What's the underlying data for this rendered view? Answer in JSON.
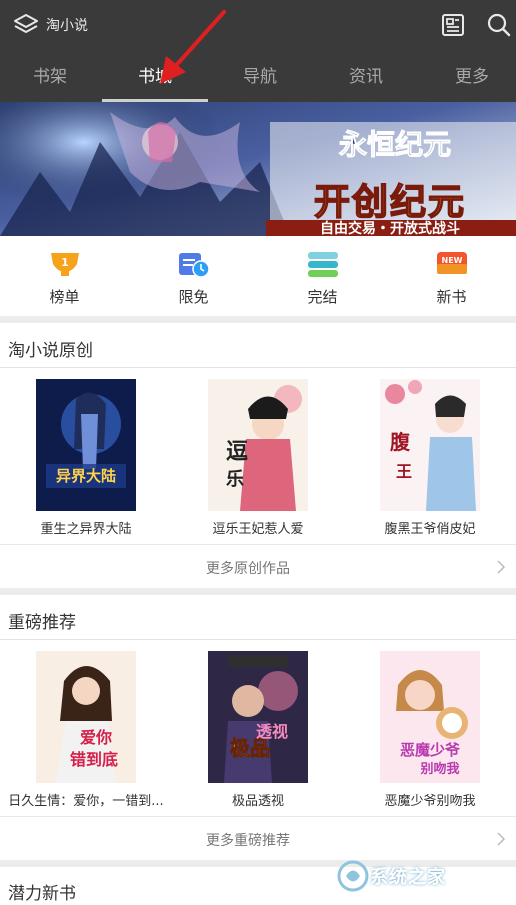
{
  "header": {
    "app_title": "淘小说",
    "logo_icon": "layers-icon",
    "actions": [
      {
        "icon": "reader-icon"
      },
      {
        "icon": "search-icon"
      }
    ]
  },
  "tabs": [
    {
      "label": "书架",
      "active": false
    },
    {
      "label": "书城",
      "active": true
    },
    {
      "label": "导航",
      "active": false
    },
    {
      "label": "资讯",
      "active": false
    },
    {
      "label": "更多",
      "active": false
    }
  ],
  "banner": {
    "title_logo": "永恒纪元",
    "headline": "开创纪元",
    "tagline": "自由交易・开放式战斗"
  },
  "quicknav": [
    {
      "label": "榜单",
      "icon": "trophy-icon"
    },
    {
      "label": "限免",
      "icon": "clock-card-icon"
    },
    {
      "label": "完结",
      "icon": "stack-icon"
    },
    {
      "label": "新书",
      "icon": "new-badge-icon"
    }
  ],
  "sections": [
    {
      "title": "淘小说原创",
      "books": [
        {
          "title": "重生之异界大陆"
        },
        {
          "title": "逗乐王妃惹人爱"
        },
        {
          "title": "腹黑王爷俏皮妃"
        }
      ],
      "more": "更多原创作品"
    },
    {
      "title": "重磅推荐",
      "books": [
        {
          "title": "日久生情：爱你，一错到..."
        },
        {
          "title": "极品透视"
        },
        {
          "title": "恶魔少爷别吻我"
        }
      ],
      "more": "更多重磅推荐"
    },
    {
      "title": "潜力新书"
    }
  ],
  "watermark": "系统之家",
  "colors": {
    "header_bg": "#3a3a3a",
    "annotation_arrow": "#e02020"
  }
}
